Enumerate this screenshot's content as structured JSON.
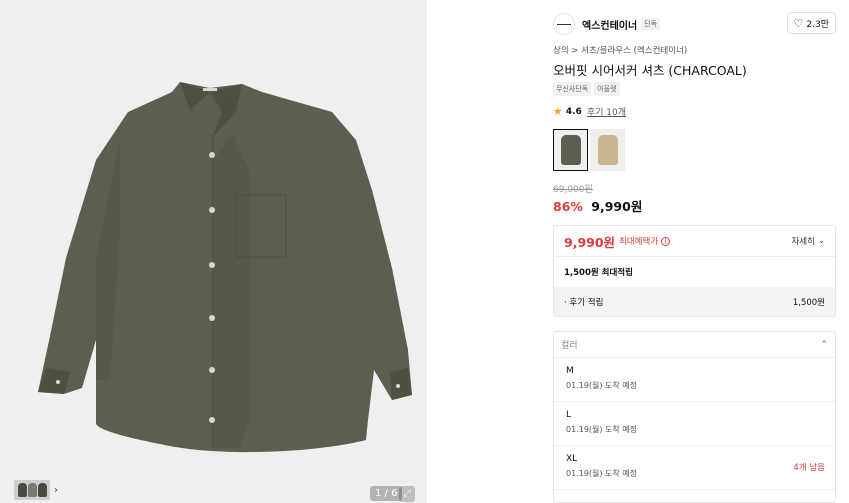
{
  "gallery": {
    "counter": "1 / 6",
    "expand_icon": "expand-icon",
    "colors": {
      "background": "#efefef",
      "shirt": "#5c5e4f"
    }
  },
  "brand": {
    "name": "엑스컨테이너",
    "tag": "단독",
    "likes": "2.3만"
  },
  "product": {
    "breadcrumb": "상의 > 셔츠/블라우스 (엑스컨테이너)",
    "title": "오버핏 시어서커 셔츠 (CHARCOAL)",
    "tags": [
      "무신사단독",
      "아울렛"
    ],
    "rating": "4.6",
    "reviews": "후기 10개",
    "swatches": [
      {
        "name": "charcoal",
        "color": "#5c5e50",
        "selected": true
      },
      {
        "name": "beige",
        "color": "#c8b78f",
        "selected": false
      }
    ]
  },
  "price": {
    "original": "69,000원",
    "discount": "86%",
    "sale": "9,990원"
  },
  "benefit": {
    "price": "9,990원",
    "label": "최대혜택가",
    "detail": "자세히",
    "points_total": "1,500원 최대적립",
    "review_label": "· 후기 적립",
    "review_amount": "1,500원"
  },
  "options": {
    "header": "컬러",
    "items": [
      {
        "size": "M",
        "date": "01.19(월) 도착 예정",
        "stock": ""
      },
      {
        "size": "L",
        "date": "01.19(월) 도착 예정",
        "stock": ""
      },
      {
        "size": "XL",
        "date": "01.19(월) 도착 예정",
        "stock": "4개 남음"
      }
    ]
  },
  "accent": {
    "red": "#e03b3b",
    "star": "#f5a623"
  }
}
